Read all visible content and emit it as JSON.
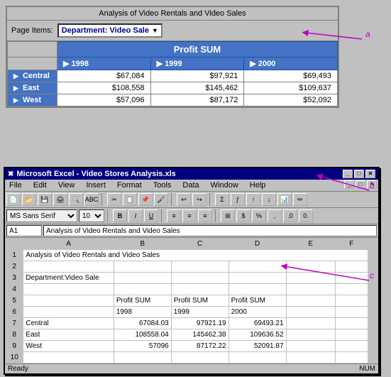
{
  "pivot": {
    "title": "Analysis of Video Rentals and Video Sales",
    "page_items_label": "Page Items:",
    "dept_dropdown": "Department: Video Sale",
    "profit_sum_header": "Profit SUM",
    "years": [
      "1998",
      "1999",
      "2000"
    ],
    "rows": [
      {
        "label": "Central",
        "values": [
          "$67,084",
          "$97,921",
          "$69,493"
        ]
      },
      {
        "label": "East",
        "values": [
          "$108,558",
          "$145,462",
          "$109,637"
        ]
      },
      {
        "label": "West",
        "values": [
          "$57,096",
          "$87,172",
          "$52,092"
        ]
      }
    ]
  },
  "excel": {
    "title": "Microsoft Excel - Video Stores Analysis.xls",
    "icon": "✖",
    "menu_items": [
      "File",
      "Edit",
      "View",
      "Insert",
      "Format",
      "Tools",
      "Data",
      "Window",
      "Help"
    ],
    "cell_ref": "A1",
    "formula": "Analysis of Video Rentals and Video Sales",
    "font": "MS Sans Serif",
    "font_size": "10",
    "toolbar_btns": [
      "💾",
      "🖨",
      "👁",
      "✂",
      "📋",
      "↩",
      "↪",
      "Σ",
      "ƒ",
      "↑↓",
      "AZ"
    ],
    "format_btns": [
      "B",
      "I",
      "U",
      "≡",
      "≡",
      "≡",
      "$",
      "%"
    ],
    "grid": {
      "col_headers": [
        "",
        "A",
        "B",
        "C",
        "D",
        "E",
        "F"
      ],
      "rows": [
        {
          "num": "1",
          "cells": [
            "Analysis of Video Rentals and Video Sales",
            "",
            "",
            "",
            "",
            ""
          ]
        },
        {
          "num": "2",
          "cells": [
            "",
            "",
            "",
            "",
            "",
            ""
          ]
        },
        {
          "num": "3",
          "cells": [
            "Department:Video Sale",
            "",
            "",
            "",
            "",
            ""
          ]
        },
        {
          "num": "4",
          "cells": [
            "",
            "",
            "",
            "",
            "",
            ""
          ]
        },
        {
          "num": "5",
          "cells": [
            "",
            "Profit SUM",
            "Profit SUM",
            "Profit SUM",
            "",
            ""
          ]
        },
        {
          "num": "6",
          "cells": [
            "",
            "1998",
            "1999",
            "2000",
            "",
            ""
          ]
        },
        {
          "num": "7",
          "cells": [
            "Central",
            "67084.03",
            "97921.19",
            "69493.21",
            "",
            ""
          ]
        },
        {
          "num": "8",
          "cells": [
            "East",
            "108558.04",
            "145462.38",
            "109636.52",
            "",
            ""
          ]
        },
        {
          "num": "9",
          "cells": [
            "West",
            "57096",
            "87172.22",
            "52091.87",
            "",
            ""
          ]
        },
        {
          "num": "10",
          "cells": [
            "",
            "",
            "",
            "",
            "",
            ""
          ]
        }
      ]
    }
  },
  "labels": {
    "a": "a",
    "b": "b",
    "c": "c"
  }
}
